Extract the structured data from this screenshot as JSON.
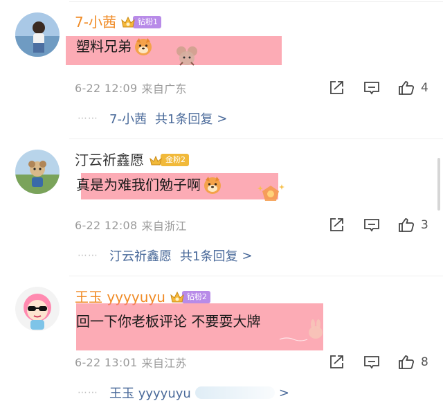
{
  "comments": [
    {
      "username": "7-小茜",
      "badge": "钻粉1",
      "text": "塑料兄弟",
      "time": "6-22 12:09",
      "location": "来自广东",
      "likes": "4",
      "reply_user": "7-小茜",
      "reply_total": "共1条回复",
      "reply_arrow": ">"
    },
    {
      "username": "汀云祈鑫愿",
      "badge": "金粉2",
      "text": "真是为难我们勉子啊",
      "time": "6-22 12:08",
      "location": "来自浙江",
      "likes": "3",
      "reply_user": "汀云祈鑫愿",
      "reply_total": "共1条回复",
      "reply_arrow": ">"
    },
    {
      "username": "王玉 yyyyuyu",
      "badge": "钻粉2",
      "text": "回一下你老板评论 不要耍大牌",
      "time": "6-22 13:01",
      "location": "来自江苏",
      "likes": "8",
      "reply_user": "王玉 yyyyuyu",
      "reply_total": "",
      "reply_arrow": ">"
    }
  ],
  "dots": "⋯⋯",
  "colors": {
    "username_orange": "#f08a24",
    "reply_blue": "#4a6a9a",
    "highlight": "#fa7887",
    "badge_purple": "#b88be8",
    "badge_gold": "#f1b93a"
  },
  "icons": [
    "share-icon",
    "comment-icon",
    "thumbs-up-icon",
    "crown-icon",
    "dog-emoji-icon"
  ]
}
